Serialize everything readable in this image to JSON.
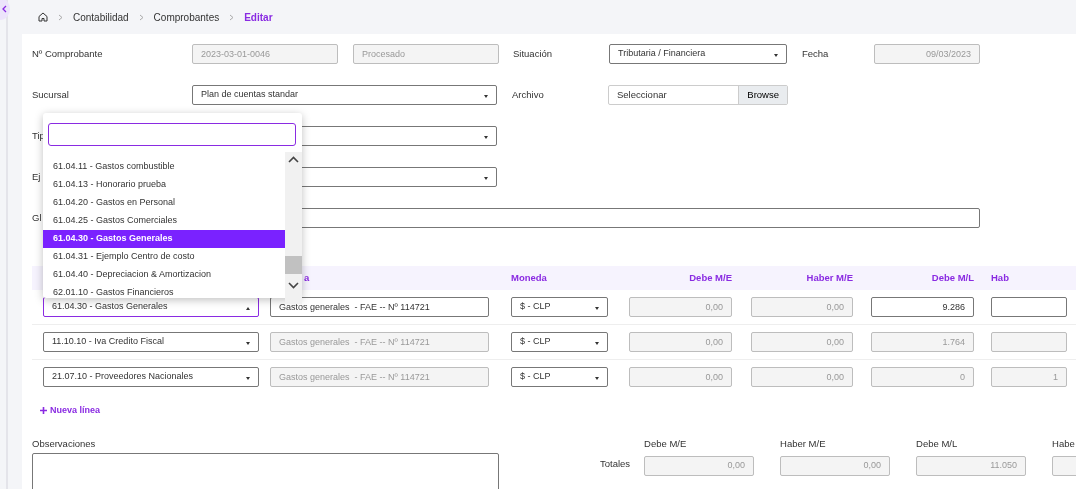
{
  "breadcrumb": [
    {
      "label": "Contabilidad",
      "selected": false
    },
    {
      "label": "Comprobantes",
      "selected": false
    },
    {
      "label": "Editar",
      "selected": true
    }
  ],
  "comprobante": {
    "label": "Nº Comprobante",
    "number": "2023-03-01-0046",
    "status": "Procesado"
  },
  "situacion": {
    "label": "Situación",
    "value": "Tributaria / Financiera"
  },
  "fecha": {
    "label": "Fecha",
    "value": "09/03/2023"
  },
  "sucursal": {
    "label": "Sucursal",
    "value": "Plan de cuentas standar"
  },
  "archivo": {
    "label": "Archivo",
    "placeholder": "Seleccionar",
    "button": "Browse"
  },
  "tipo": {
    "label": "Tip"
  },
  "ejercicio": {
    "label": "Ej"
  },
  "glosa": {
    "label": "Gl"
  },
  "table": {
    "columns": [
      "",
      "a",
      "Moneda",
      "Debe M/E",
      "Haber M/E",
      "Debe M/L",
      "Hab"
    ],
    "rows": [
      {
        "cells": [
          {
            "kind": "select",
            "value": "61.04.30 - Gastos Generales",
            "expanded": true
          },
          {
            "kind": "input",
            "value": "Gastos generales  - FAE -- Nº 114721",
            "disabled": false
          },
          {
            "kind": "select",
            "value": "$ - CLP",
            "expanded": false
          },
          {
            "kind": "input",
            "value": "0,00",
            "disabled": true
          },
          {
            "kind": "input",
            "value": "0,00",
            "disabled": true
          },
          {
            "kind": "input",
            "value": "9.286",
            "disabled": false
          },
          {
            "kind": "input",
            "disabled": false
          }
        ]
      },
      {
        "cells": [
          {
            "kind": "select",
            "value": "11.10.10 - Iva Credito Fiscal",
            "expanded": false
          },
          {
            "kind": "input",
            "value": "Gastos generales  - FAE -- Nº 114721",
            "disabled": true
          },
          {
            "kind": "select",
            "value": "$ - CLP",
            "expanded": false
          },
          {
            "kind": "input",
            "value": "0,00",
            "disabled": true
          },
          {
            "kind": "input",
            "value": "0,00",
            "disabled": true
          },
          {
            "kind": "input",
            "value": "1.764",
            "disabled": true
          },
          {
            "kind": "input",
            "disabled": true
          }
        ]
      },
      {
        "cells": [
          {
            "kind": "select",
            "value": "21.07.10 - Proveedores Nacionales",
            "expanded": false
          },
          {
            "kind": "input",
            "value": "Gastos generales  - FAE -- Nº 114721",
            "disabled": true
          },
          {
            "kind": "select",
            "value": "$ - CLP",
            "expanded": false
          },
          {
            "kind": "input",
            "value": "0,00",
            "disabled": true
          },
          {
            "kind": "input",
            "value": "0,00",
            "disabled": true
          },
          {
            "kind": "input",
            "value": "0",
            "disabled": true
          },
          {
            "kind": "input",
            "value": "1",
            "disabled": true
          }
        ]
      }
    ]
  },
  "new_line": "Nueva línea",
  "observaciones": {
    "label": "Observaciones"
  },
  "totales": {
    "label": "Totales",
    "columns": [
      {
        "label": "Debe M/E",
        "value": "0,00"
      },
      {
        "label": "Haber M/E",
        "value": "0,00"
      },
      {
        "label": "Debe M/L",
        "value": "11.050"
      },
      {
        "label": "Habe"
      }
    ]
  },
  "dropdown": {
    "options": [
      {
        "label": "61.04.11 - Gastos combustible",
        "selected": false
      },
      {
        "label": "61.04.13 - Honorario prueba",
        "selected": false
      },
      {
        "label": "61.04.20 - Gastos en Personal",
        "selected": false
      },
      {
        "label": "61.04.25 - Gastos Comerciales",
        "selected": false
      },
      {
        "label": "61.04.30 - Gastos Generales",
        "selected": true
      },
      {
        "label": "61.04.31 - Ejemplo Centro de costo",
        "selected": false
      },
      {
        "label": "61.04.40 - Depreciacion & Amortizacion",
        "selected": false
      },
      {
        "label": "62.01.10 - Gastos Financieros",
        "selected": false
      }
    ]
  }
}
